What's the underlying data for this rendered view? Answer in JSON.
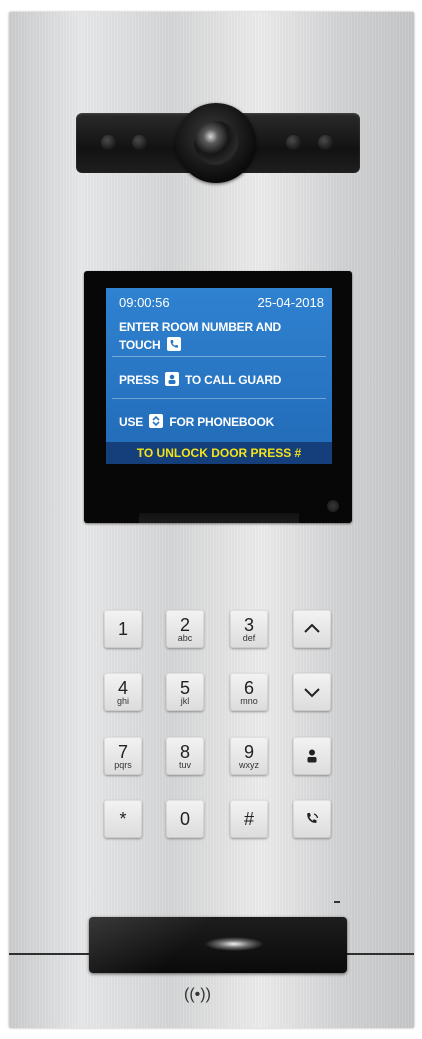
{
  "screen": {
    "time": "09:00:56",
    "date": "25-04-2018",
    "line1": "ENTER ROOM NUMBER AND",
    "line2_text": "TOUCH",
    "line3_pre": "PRESS",
    "line3_post": "TO CALL GUARD",
    "line4_pre": "USE",
    "line4_post": "FOR PHONEBOOK",
    "footer": "TO UNLOCK  DOOR PRESS #",
    "colors": {
      "background": "#2a79c7",
      "footer_bg": "#153f7a",
      "footer_text": "#f4e21a"
    }
  },
  "keypad": {
    "keys": [
      {
        "num": "1",
        "sub": ""
      },
      {
        "num": "2",
        "sub": "abc"
      },
      {
        "num": "3",
        "sub": "def"
      },
      {
        "num": "4",
        "sub": "ghi"
      },
      {
        "num": "5",
        "sub": "jkl"
      },
      {
        "num": "6",
        "sub": "mno"
      },
      {
        "num": "7",
        "sub": "pqrs"
      },
      {
        "num": "8",
        "sub": "tuv"
      },
      {
        "num": "9",
        "sub": "wxyz"
      },
      {
        "num": "*",
        "sub": ""
      },
      {
        "num": "0",
        "sub": ""
      },
      {
        "num": "#",
        "sub": ""
      }
    ],
    "function_keys": [
      "chevron-up-icon",
      "chevron-down-icon",
      "guard-icon",
      "call-icon"
    ]
  },
  "card_reader": {
    "icon": "nfc-icon",
    "label": "((•))"
  }
}
